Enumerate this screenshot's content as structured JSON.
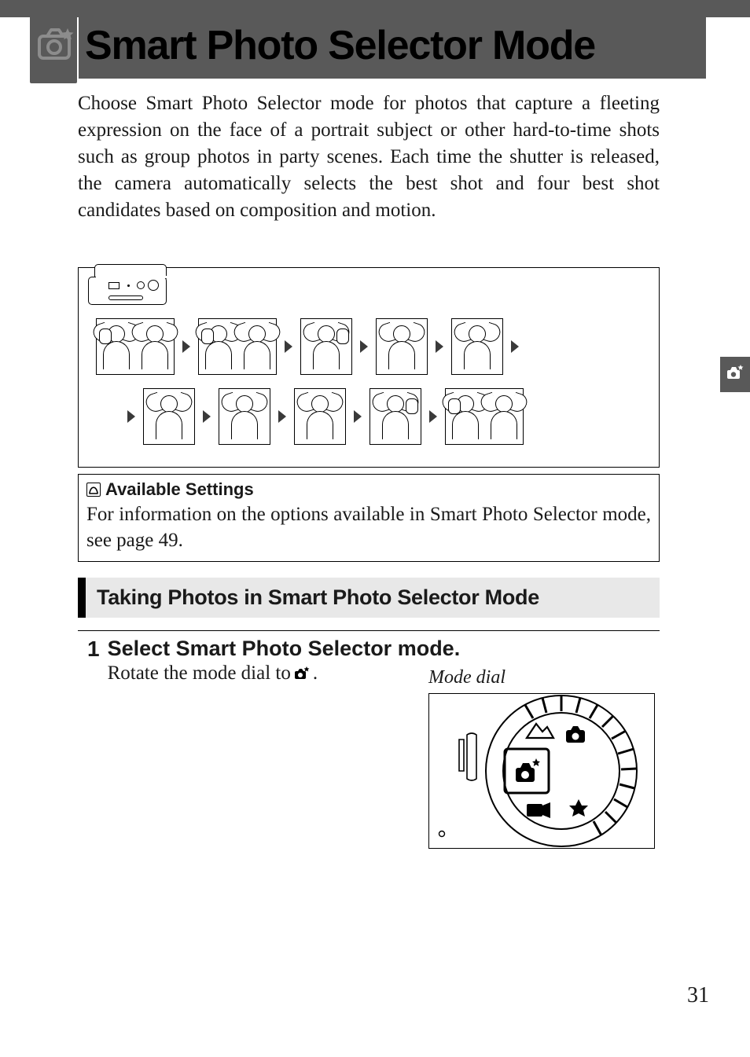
{
  "page": {
    "title": "Smart Photo Selector Mode",
    "number": "31"
  },
  "intro": "Choose Smart Photo Selector mode for photos that capture a fleeting expression on the face of a portrait subject or other hard-to-time shots such as group photos in party scenes.  Each time the shutter is released, the camera automatically selects the best shot and four best shot candidates based on composition and motion.",
  "note": {
    "title": "Available Settings",
    "body": "For information on the options available in Smart Photo Selector mode, see page 49."
  },
  "section": {
    "title": "Taking Photos in Smart Photo Selector Mode"
  },
  "step1": {
    "number": "1",
    "heading": "Select Smart Photo Selector mode.",
    "text_before": "Rotate the mode dial to ",
    "text_after": ".",
    "illustration_label": "Mode dial"
  },
  "icons": {
    "smart_photo_selector": "smart-photo-selector-icon",
    "note": "note-icon"
  }
}
